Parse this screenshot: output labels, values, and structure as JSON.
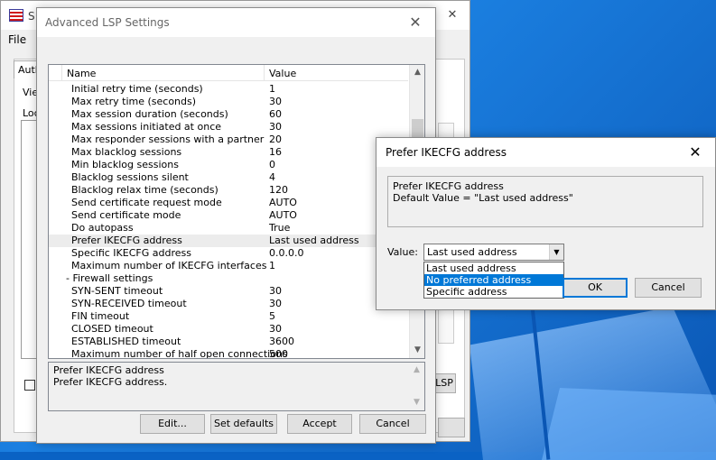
{
  "main_window": {
    "title": "S",
    "menu_file": "File",
    "tab_label": "Auth",
    "view_label": "View",
    "loc_label": "Loc",
    "lsp_button": "LSP",
    "minimize": "–",
    "close": "✕"
  },
  "lsp_settings": {
    "title": "Advanced LSP Settings",
    "close": "✕",
    "col_name": "Name",
    "col_value": "Value",
    "rows": [
      {
        "name": "Initial retry time (seconds)",
        "value": "1"
      },
      {
        "name": "Max retry time (seconds)",
        "value": "30"
      },
      {
        "name": "Max session duration (seconds)",
        "value": "60"
      },
      {
        "name": "Max sessions initiated at once",
        "value": "30"
      },
      {
        "name": "Max responder sessions with a partner",
        "value": "20"
      },
      {
        "name": "Max blacklog sessions",
        "value": "16"
      },
      {
        "name": "Min blacklog sessions",
        "value": "0"
      },
      {
        "name": "Blacklog sessions silent",
        "value": "4"
      },
      {
        "name": "Blacklog relax time (seconds)",
        "value": "120"
      },
      {
        "name": "Send certificate request mode",
        "value": "AUTO"
      },
      {
        "name": "Send certificate mode",
        "value": "AUTO"
      },
      {
        "name": "Do autopass",
        "value": "True"
      },
      {
        "name": "Prefer IKECFG address",
        "value": "Last used address"
      },
      {
        "name": "Specific IKECFG address",
        "value": "0.0.0.0"
      },
      {
        "name": "Maximum number of IKECFG interfaces",
        "value": "1"
      },
      {
        "name": "-  Firewall settings",
        "value": ""
      },
      {
        "name": "SYN-SENT timeout",
        "value": "30"
      },
      {
        "name": "SYN-RECEIVED timeout",
        "value": "30"
      },
      {
        "name": "FIN timeout",
        "value": "5"
      },
      {
        "name": "CLOSED timeout",
        "value": "30"
      },
      {
        "name": "ESTABLISHED timeout",
        "value": "3600"
      },
      {
        "name": "Maximum number of half open connections",
        "value": "500"
      }
    ],
    "description_title": "Prefer IKECFG address",
    "description_text": "Prefer IKECFG address.",
    "buttons": {
      "edit": "Edit...",
      "set_defaults": "Set defaults",
      "accept": "Accept",
      "cancel": "Cancel"
    }
  },
  "prefer_dialog": {
    "title": "Prefer IKECFG address",
    "close": "✕",
    "desc_line1": "Prefer IKECFG address",
    "desc_line2": "Default Value = \"Last used address\"",
    "value_label": "Value:",
    "selected_value": "Last used address",
    "options": [
      "Last used address",
      "No preferred address",
      "Specific address"
    ],
    "highlighted_option": "No preferred address",
    "ok": "OK",
    "cancel": "Cancel"
  },
  "icons": {
    "scroll_up": "▲",
    "scroll_down": "▼",
    "dropdown": "▼"
  },
  "colors": {
    "selection": "#0078d7",
    "desktop": "#0a62c4"
  }
}
